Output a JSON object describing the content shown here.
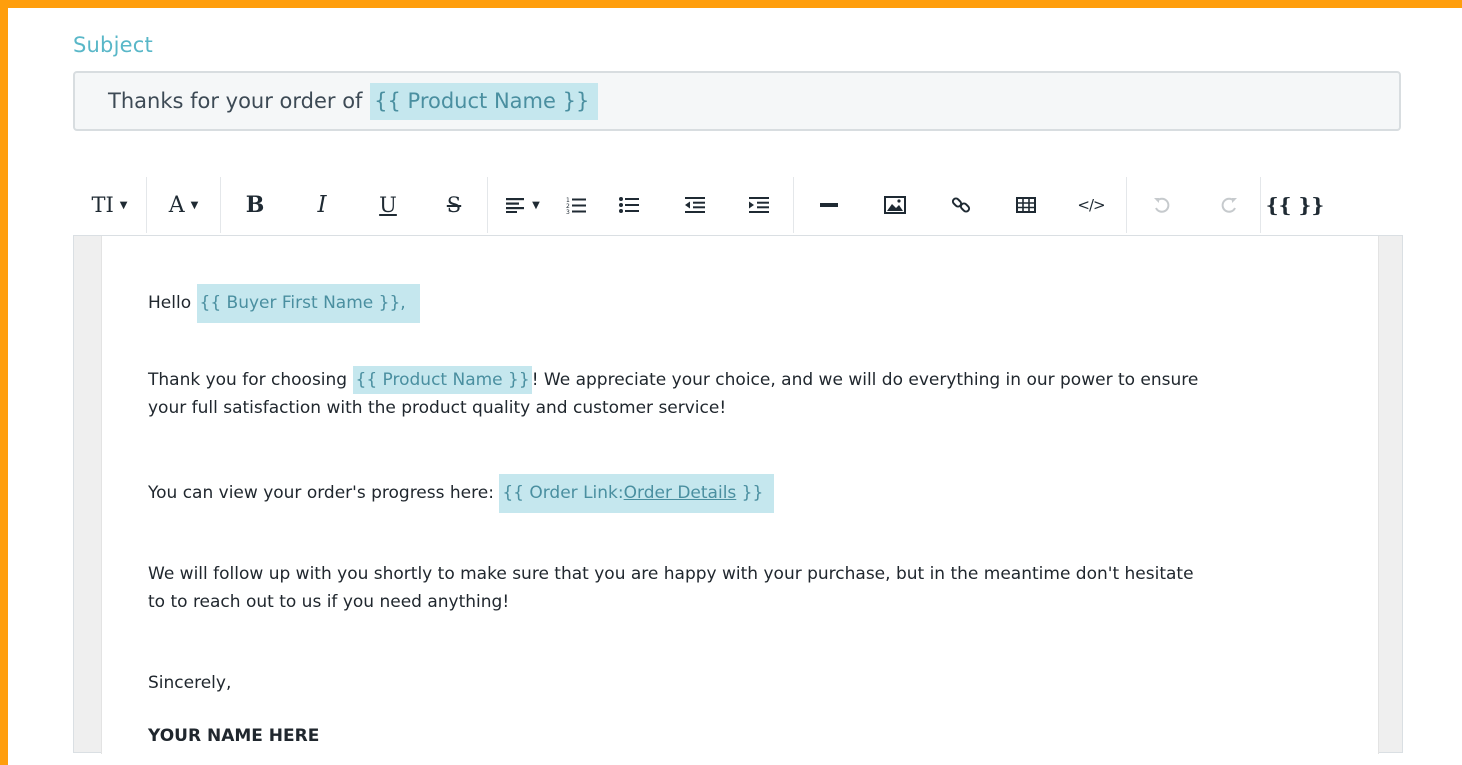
{
  "subject": {
    "label": "Subject",
    "prefix": "Thanks for your order of ",
    "token": "{{ Product Name }}"
  },
  "toolbar": {
    "text_size_label": "TI",
    "font_color_label": "A",
    "bold_label": "B",
    "italic_label": "I",
    "underline_label": "U",
    "strike_label": "S",
    "variables_label": "{{ }}"
  },
  "email": {
    "greeting": {
      "prefix": "Hello ",
      "token": "{{ Buyer First Name }},"
    },
    "thanks": {
      "prefix": "Thank you for choosing ",
      "token": "{{ Product Name }}",
      "suffix": "! We appreciate your choice, and we will do everything in our power to ensure",
      "line2": "your full satisfaction with the product quality and customer service!"
    },
    "progress": {
      "prefix": "You can view your order's progress here: ",
      "token_start": "{{ Order Link:",
      "link_text": "Order Details",
      "token_end": " }}"
    },
    "followup": {
      "line1": "We will follow up with you shortly to make sure that you are happy with your purchase, but in the meantime don't hesitate",
      "line2": "to to reach out to us if you need anything!"
    },
    "closing": "Sincerely,",
    "signature": "YOUR NAME HERE"
  }
}
